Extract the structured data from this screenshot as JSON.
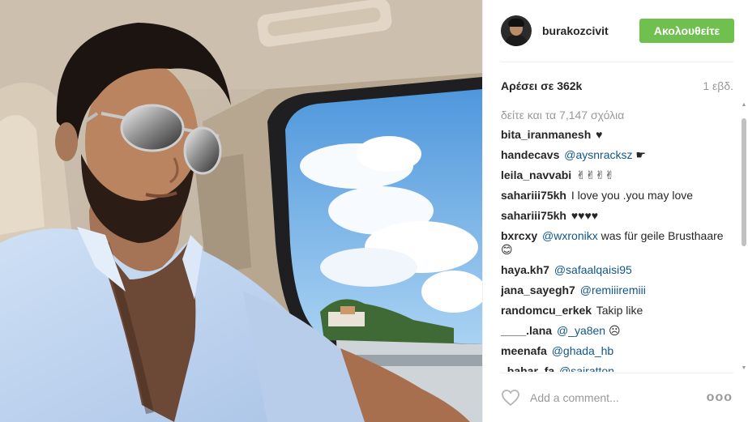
{
  "post": {
    "username": "burakozcivit",
    "follow_label": "Ακολουθείτε",
    "likes": "Αρέσει σε 362k",
    "time": "1 εβδ.",
    "view_all": "δείτε και τα 7,147 σχόλια",
    "add_comment_placeholder": "Add a comment...",
    "more_label": "ooo"
  },
  "comments": [
    {
      "user": "bita_iranmanesh",
      "mention": "",
      "text": "♥"
    },
    {
      "user": "handecavs",
      "mention": "@aysnracksz",
      "text": "☛"
    },
    {
      "user": "leila_navvabi",
      "mention": "",
      "text": "✌✌✌✌"
    },
    {
      "user": "sahariii75kh",
      "mention": "",
      "text": "I love you .you may love"
    },
    {
      "user": "sahariii75kh",
      "mention": "",
      "text": "♥♥♥♥"
    },
    {
      "user": "bxrcxy",
      "mention": "@wxronikx",
      "text": "was für geile Brusthaare😊"
    },
    {
      "user": "haya.kh7",
      "mention": "@safaalqaisi95",
      "text": ""
    },
    {
      "user": "jana_sayegh7",
      "mention": "@remiiiremiii",
      "text": ""
    },
    {
      "user": "randomcu_erkek",
      "mention": "",
      "text": "Takip like"
    },
    {
      "user": "____.lana",
      "mention": "@_ya8en",
      "text": "☹"
    },
    {
      "user": "meenafa",
      "mention": "@ghada_hb",
      "text": ""
    },
    {
      "user": "_bahar_fa",
      "mention": "@sairatton",
      "text": ""
    }
  ],
  "icons": {
    "like": "heart-icon",
    "more": "more-options-icon",
    "avatar": "avatar"
  },
  "colors": {
    "follow_button": "#70c050",
    "mention": "#125688",
    "muted": "#999999"
  }
}
